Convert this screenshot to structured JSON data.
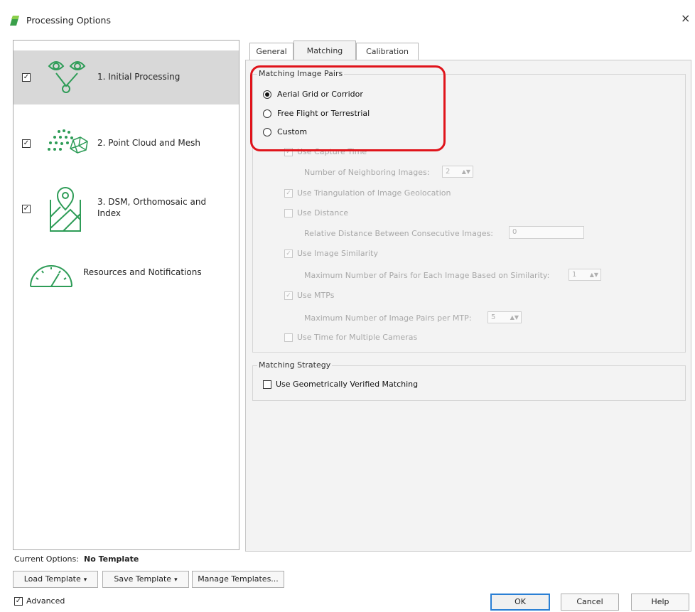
{
  "window": {
    "title": "Processing Options",
    "close_glyph": "×"
  },
  "sidebar": {
    "items": [
      {
        "label": "1. Initial Processing",
        "checked": true,
        "icon": "initial-processing-icon"
      },
      {
        "label": "2. Point Cloud and Mesh",
        "checked": true,
        "icon": "point-cloud-icon"
      },
      {
        "label_line1": "3. DSM, Orthomosaic and",
        "label_line2": "Index",
        "checked": true,
        "icon": "map-pin-icon"
      },
      {
        "label": "Resources and Notifications",
        "icon": "gauge-icon"
      }
    ]
  },
  "tabs": [
    {
      "label": "General",
      "active": false
    },
    {
      "label": "Matching",
      "active": true
    },
    {
      "label": "Calibration",
      "active": false
    }
  ],
  "matching_image_pairs": {
    "title": "Matching Image Pairs",
    "options": [
      {
        "label": "Aerial Grid or Corridor",
        "selected": true
      },
      {
        "label": "Free Flight or Terrestrial",
        "selected": false
      },
      {
        "label": "Custom",
        "selected": false
      }
    ],
    "custom": {
      "use_capture_time": "Use Capture Time",
      "neighboring_images_label": "Number of Neighboring Images:",
      "neighboring_images_value": "2",
      "use_triangulation": "Use Triangulation of Image Geolocation",
      "use_distance": "Use Distance",
      "relative_distance_label": "Relative Distance Between Consecutive Images:",
      "relative_distance_value": "0",
      "use_image_similarity": "Use Image Similarity",
      "max_pairs_similarity_label": "Maximum Number of Pairs for Each Image Based on Similarity:",
      "max_pairs_similarity_value": "1",
      "use_mtps": "Use MTPs",
      "max_pairs_mtp_label": "Maximum Number of Image Pairs per MTP:",
      "max_pairs_mtp_value": "5",
      "use_time_multiple": "Use Time for Multiple Cameras"
    }
  },
  "matching_strategy": {
    "title": "Matching Strategy",
    "geometric_label": "Use Geometrically Verified Matching"
  },
  "footer": {
    "current_options_label": "Current Options:",
    "current_options_value": "No Template",
    "load_template": "Load Template",
    "save_template": "Save Template",
    "manage_templates": "Manage Templates...",
    "advanced_label": "Advanced",
    "ok": "OK",
    "cancel": "Cancel",
    "help": "Help"
  },
  "colors": {
    "highlight": "#e0141b",
    "selected_bg": "#d8d8d8",
    "content_bg": "#f3f3f3",
    "icon_green": "#2e9c57"
  }
}
